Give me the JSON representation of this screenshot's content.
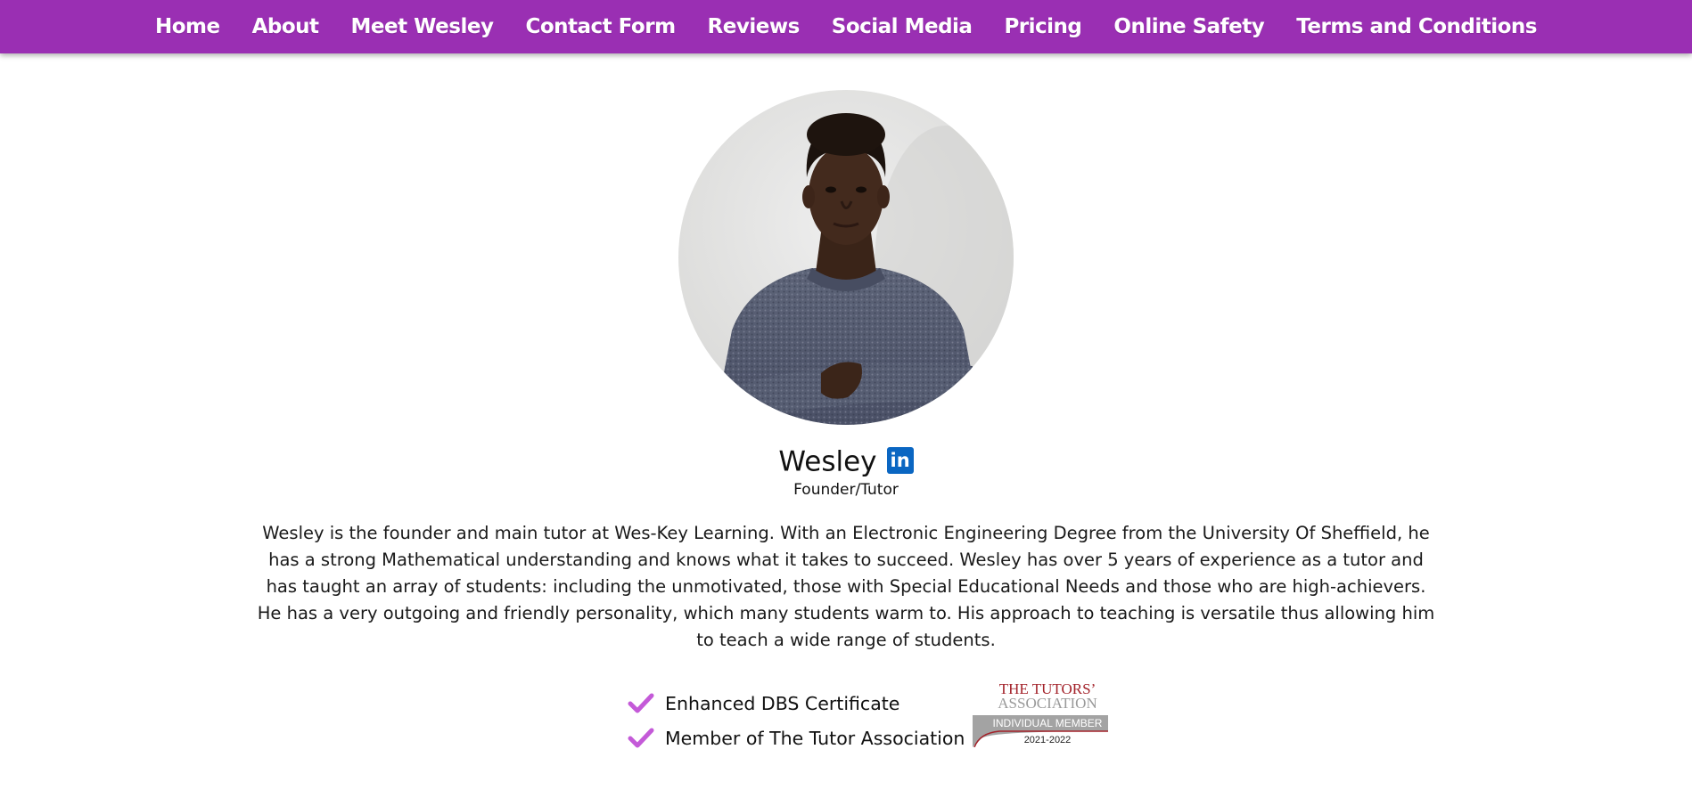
{
  "nav": {
    "items": [
      {
        "label": "Home"
      },
      {
        "label": "About"
      },
      {
        "label": "Meet Wesley"
      },
      {
        "label": "Contact Form"
      },
      {
        "label": "Reviews"
      },
      {
        "label": "Social Media"
      },
      {
        "label": "Pricing"
      },
      {
        "label": "Online Safety"
      },
      {
        "label": "Terms and Conditions"
      }
    ]
  },
  "colors": {
    "nav_background": "#9a2fb3",
    "check_color": "#c45ad8",
    "linkedin_blue": "#0a66c2"
  },
  "profile": {
    "name": "Wesley",
    "linkedin_icon_label": "in",
    "role": "Founder/Tutor",
    "bio": "Wesley is the founder and main tutor at Wes-Key Learning. With an Electronic Engineering Degree from the University Of Sheffield, he has a strong Mathematical understanding and knows what it takes to succeed. Wesley has over 5 years of experience as a tutor and has taught an array of students: including the unmotivated, those with Special Educational Needs and those who are high-achievers. He has a very outgoing and friendly personality, which many students warm to. His approach to teaching is versatile thus allowing him to teach a wide range of students."
  },
  "qualifications": [
    {
      "icon": "check-icon",
      "label": "Enhanced DBS Certificate"
    },
    {
      "icon": "check-icon",
      "label": "Member of The Tutor Association"
    }
  ],
  "badge": {
    "line1": "THE TUTORS’",
    "line2": "ASSOCIATION",
    "line3": "INDIVIDUAL MEMBER",
    "line4": "2021-2022"
  }
}
